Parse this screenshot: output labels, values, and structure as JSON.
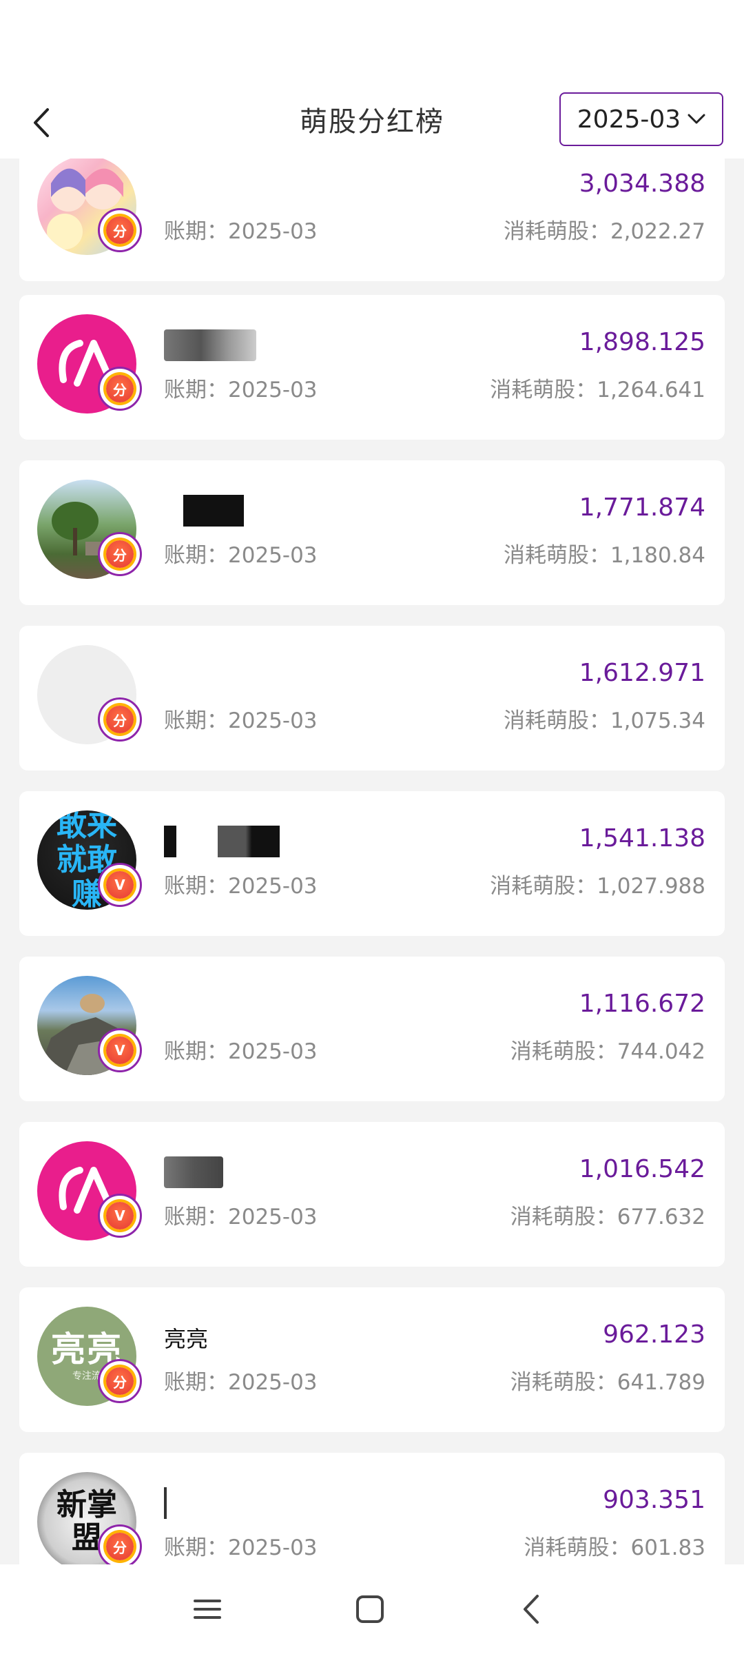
{
  "header": {
    "title": "萌股分红榜",
    "date_select": "2025-03"
  },
  "labels": {
    "period_prefix": "账期：",
    "consume_prefix": "消耗萌股："
  },
  "rows": [
    {
      "name": "",
      "avatar": "anime",
      "badge": "分",
      "period": "2025-03",
      "amount": "3,034.388",
      "consume": "2,022.27"
    },
    {
      "name": "",
      "avatar": "pink-logo",
      "badge": "分",
      "period": "2025-03",
      "amount": "1,898.125",
      "consume": "1,264.641"
    },
    {
      "name": "",
      "avatar": "landscape-tree",
      "badge": "分",
      "period": "2025-03",
      "amount": "1,771.874",
      "consume": "1,180.84"
    },
    {
      "name": "",
      "avatar": "blank",
      "badge": "分",
      "period": "2025-03",
      "amount": "1,612.971",
      "consume": "1,075.34"
    },
    {
      "name": "",
      "avatar": "dark-text",
      "badge": "V",
      "period": "2025-03",
      "amount": "1,541.138",
      "consume": "1,027.988"
    },
    {
      "name": "",
      "avatar": "rock-landscape",
      "badge": "V",
      "period": "2025-03",
      "amount": "1,116.672",
      "consume": "744.042"
    },
    {
      "name": "",
      "avatar": "pink-logo",
      "badge": "V",
      "period": "2025-03",
      "amount": "1,016.542",
      "consume": "677.632"
    },
    {
      "name": "亮亮",
      "avatar": "green-text",
      "badge": "分",
      "period": "2025-03",
      "amount": "962.123",
      "consume": "641.789"
    },
    {
      "name": "",
      "avatar": "ink-text",
      "badge": "分",
      "period": "2025-03",
      "amount": "903.351",
      "consume": "601.83"
    }
  ],
  "avatar_texts": {
    "dark_text": "敢来就敢赚",
    "green_text": "亮亮",
    "green_sub": "专注流",
    "ink_text": "新掌盟"
  },
  "colors": {
    "accent": "#6a1b9a",
    "pink_logo": "#e91e8c",
    "background": "#f3f3f3"
  }
}
